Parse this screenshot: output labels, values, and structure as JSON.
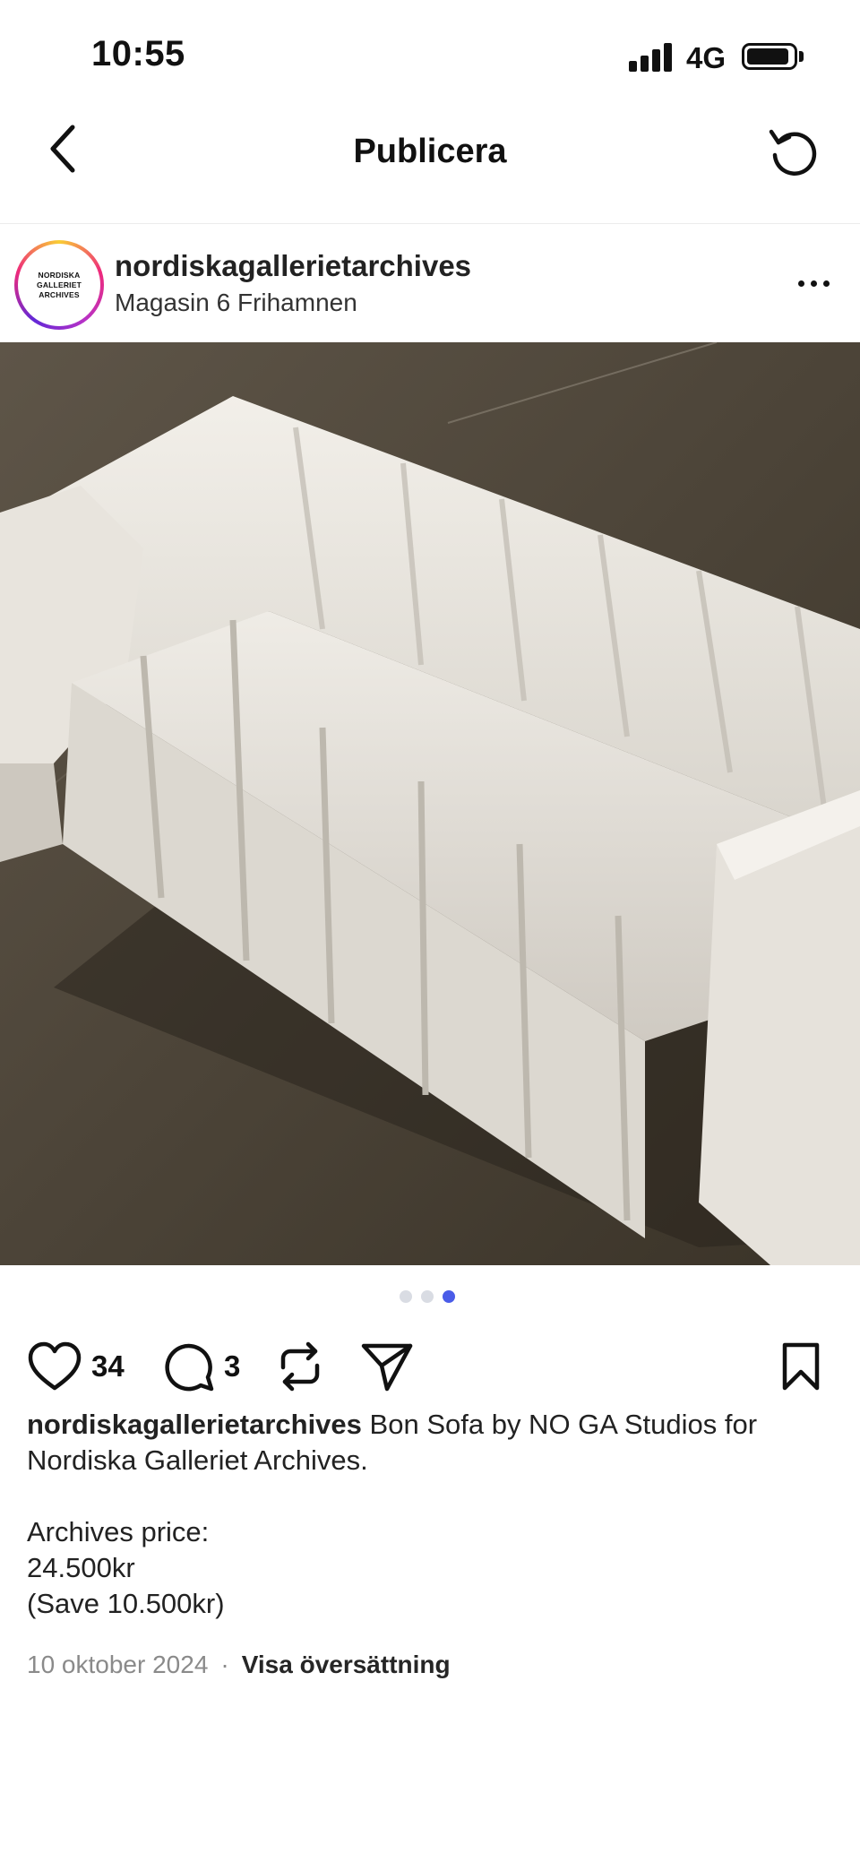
{
  "status_bar": {
    "time": "10:55",
    "network": "4G",
    "battery_level": 0.85
  },
  "nav": {
    "title": "Publicera",
    "back_icon": "chevron-left-icon",
    "refresh_icon": "refresh-icon"
  },
  "post": {
    "username": "nordiskagallerietarchives",
    "location": "Magasin 6 Frihamnen",
    "avatar_lines": [
      "NORDISKA",
      "GALLERIET",
      "ARCHIVES"
    ],
    "image_subject": "white boucle sofa on concrete floor",
    "carousel": {
      "total": 3,
      "active_index": 2
    },
    "actions": {
      "likes": "34",
      "comments": "3"
    },
    "caption": {
      "text": "Bon Sofa by NO GA Studios for Nordiska Galleriet Archives.",
      "lines": [
        "Archives price:",
        "24.500kr",
        "(Save 10.500kr)"
      ]
    },
    "date": "10 oktober 2024",
    "separator": "·",
    "translate_label": "Visa översättning"
  },
  "colors": {
    "accent_dot": "#4a5ce8",
    "inactive_dot": "#d9dce3",
    "meta_gray": "#8a8a8a"
  }
}
